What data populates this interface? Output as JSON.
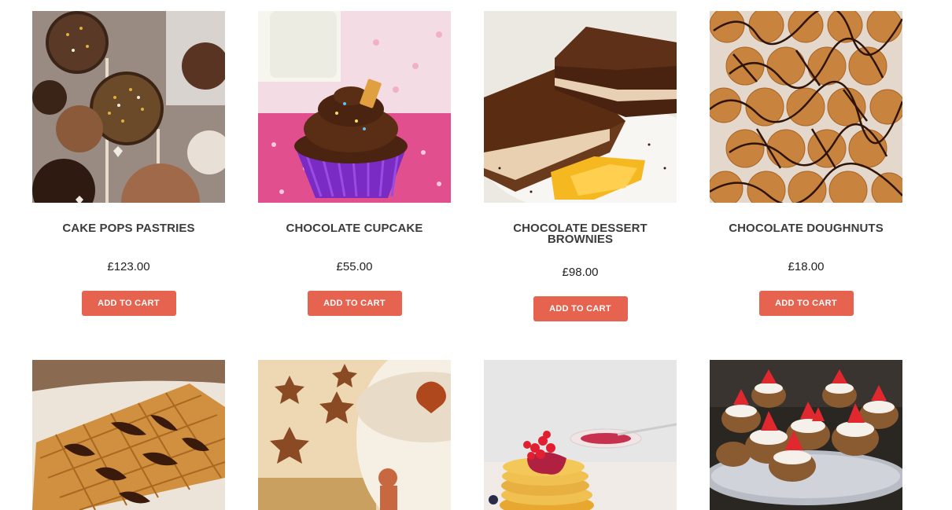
{
  "products": [
    {
      "title": "CAKE POPS PASTRIES",
      "price": "£123.00",
      "button": "ADD TO CART",
      "image": "cake-pops-photo"
    },
    {
      "title": "CHOCOLATE CUPCAKE",
      "price": "£55.00",
      "button": "ADD TO CART",
      "image": "chocolate-cupcake-photo"
    },
    {
      "title": "CHOCOLATE DESSERT BROWNIES",
      "price": "£98.00",
      "button": "ADD TO CART",
      "image": "brownies-photo"
    },
    {
      "title": "CHOCOLATE DOUGHNUTS",
      "price": "£18.00",
      "button": "ADD TO CART",
      "image": "chocolate-doughnuts-photo"
    },
    {
      "image": "chocolate-waffle-photo"
    },
    {
      "image": "star-cookies-tin-photo"
    },
    {
      "image": "berry-pancakes-photo"
    },
    {
      "image": "strawberry-tarts-photo"
    }
  ],
  "colors": {
    "button": "#e5634f",
    "title": "#3c3c3c"
  }
}
